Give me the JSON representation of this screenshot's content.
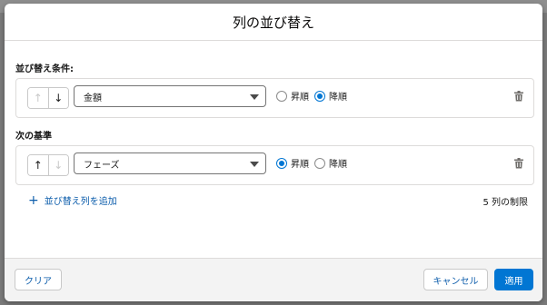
{
  "modal": {
    "title": "列の並び替え"
  },
  "sort": {
    "primary_label": "並び替え条件:",
    "secondary_label": "次の基準",
    "rows": [
      {
        "field": "金額",
        "order": "descending"
      },
      {
        "field": "フェーズ",
        "order": "ascending"
      }
    ],
    "ascending_label": "昇順",
    "descending_label": "降順",
    "up_arrow": "↑",
    "down_arrow": "↓",
    "add_label": "並び替え列を追加",
    "limit_label": "5 列の制限"
  },
  "footer": {
    "clear_label": "クリア",
    "cancel_label": "キャンセル",
    "apply_label": "適用"
  },
  "colors": {
    "brand": "#0176d3",
    "link": "#0b5cab",
    "border": "#dddbda"
  }
}
